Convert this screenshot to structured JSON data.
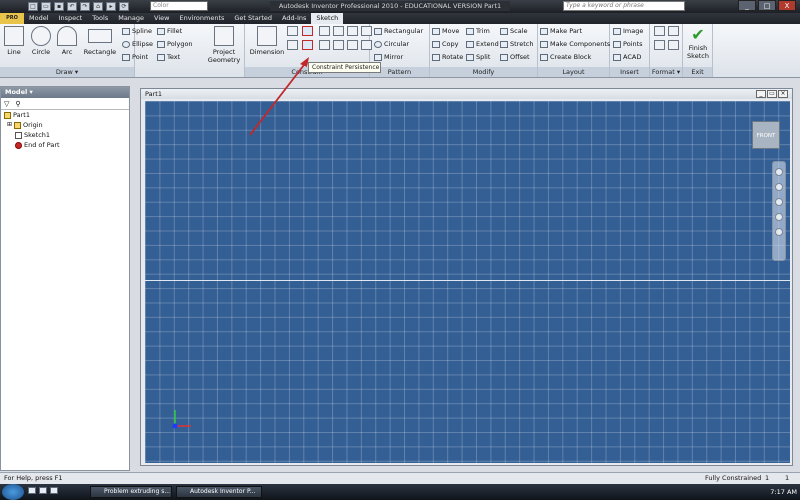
{
  "window": {
    "title": "Autodesk Inventor Professional 2010 - EDUCATIONAL VERSION    Part1",
    "minimize": "_",
    "maximize": "□",
    "close": "X"
  },
  "quick_access": {
    "color_placeholder": "Color",
    "icons": [
      "new-icon",
      "open-icon",
      "save-icon",
      "undo-icon",
      "redo-icon",
      "home-icon",
      "select-icon",
      "update-icon"
    ]
  },
  "search": {
    "placeholder": "Type a keyword or phrase"
  },
  "menu": {
    "app_button": "PRO",
    "tabs": [
      "Model",
      "Inspect",
      "Tools",
      "Manage",
      "View",
      "Environments",
      "Get Started",
      "Add-Ins",
      "Sketch"
    ],
    "active": "Sketch"
  },
  "ribbon": {
    "draw": {
      "label": "Draw ▾",
      "line": "Line",
      "circle": "Circle",
      "arc": "Arc",
      "rectangle": "Rectangle",
      "spline": "Spline",
      "ellipse": "Ellipse",
      "point": "Point",
      "fillet": "Fillet",
      "polygon": "Polygon",
      "text": "Text"
    },
    "project": {
      "label": "Project Geometry"
    },
    "constrain": {
      "label": "Constrain",
      "dimension": "Dimension"
    },
    "pattern": {
      "label": "Pattern",
      "rectangular": "Rectangular",
      "circular": "Circular",
      "mirror": "Mirror"
    },
    "modify": {
      "label": "Modify",
      "move": "Move",
      "copy": "Copy",
      "rotate": "Rotate",
      "trim": "Trim",
      "extend": "Extend",
      "split": "Split",
      "scale": "Scale",
      "stretch": "Stretch",
      "offset": "Offset"
    },
    "layout": {
      "label": "Layout",
      "make_part": "Make Part",
      "make_components": "Make Components",
      "create_block": "Create Block"
    },
    "insert": {
      "label": "Insert",
      "image": "Image",
      "points": "Points",
      "acad": "ACAD"
    },
    "format": {
      "label": "Format ▾"
    },
    "exit": {
      "label": "Exit",
      "finish": "Finish Sketch"
    }
  },
  "tooltip": "Constraint Persistence",
  "browser": {
    "title": "Model ▾",
    "tree": [
      "Part1",
      "Origin",
      "Sketch1",
      "End of Part"
    ]
  },
  "canvas": {
    "title": "Part1",
    "viewcube": "FRONT",
    "grid_color": "#345f95"
  },
  "status": {
    "help": "For Help, press F1",
    "state": "Fully Constrained",
    "count1": "1",
    "count2": "1"
  },
  "taskbar": {
    "tasks": [
      "Problem extruding s...",
      "Autodesk Inventor P..."
    ],
    "clock": "7:17 AM"
  }
}
